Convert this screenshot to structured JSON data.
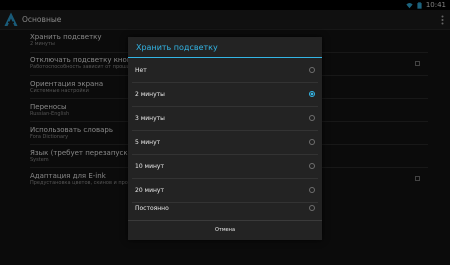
{
  "status_bar": {
    "time": "10:41",
    "wifi_icon": "wifi-icon",
    "battery_icon": "battery-icon"
  },
  "action_bar": {
    "title": "Основные",
    "app_icon": "app-logo-icon",
    "menu_icon": "overflow-menu-icon"
  },
  "settings": [
    {
      "title": "Хранить подсветку",
      "subtitle": "2 минуты"
    },
    {
      "title": "Отключать подсветку кнопок",
      "subtitle": "Работоспособность зависит от прошив"
    },
    {
      "title": "Ориентация экрана",
      "subtitle": "Системные настройки"
    },
    {
      "title": "Переносы",
      "subtitle": "Russian-English"
    },
    {
      "title": "Использовать словарь",
      "subtitle": "Fora Dictionary"
    },
    {
      "title": "Язык (требует перезапуск)",
      "subtitle": "System"
    },
    {
      "title": "Адаптация для E-ink",
      "subtitle": "Предустановка цветов, скинов и прочего"
    }
  ],
  "dialog": {
    "title": "Хранить подсветку",
    "options": [
      {
        "label": "Нет",
        "selected": false
      },
      {
        "label": "2 минуты",
        "selected": true
      },
      {
        "label": "3 минуты",
        "selected": false
      },
      {
        "label": "5 минут",
        "selected": false
      },
      {
        "label": "10 минут",
        "selected": false
      },
      {
        "label": "20 минут",
        "selected": false
      },
      {
        "label": "Постоянно",
        "selected": false
      }
    ],
    "cancel_label": "Отмена"
  },
  "colors": {
    "accent": "#33b5e5",
    "background": "#141414",
    "dialog": "#232323"
  }
}
